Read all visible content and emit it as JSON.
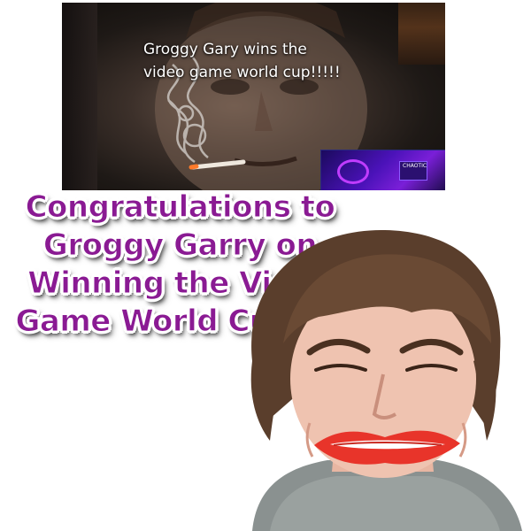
{
  "video": {
    "caption": "Groggy Gary wins the\nvideo game world cup!!!!!",
    "inset_label": "CHAOTIC"
  },
  "headline": {
    "lines": [
      "Congratulations to",
      "Groggy Garry on",
      "Winning the Video",
      "Game World Cup!!!!"
    ]
  },
  "colors": {
    "headline": "#8a1a93",
    "headline_outline": "#ffffff",
    "caption": "#ffffff",
    "background": "#ffffff"
  }
}
